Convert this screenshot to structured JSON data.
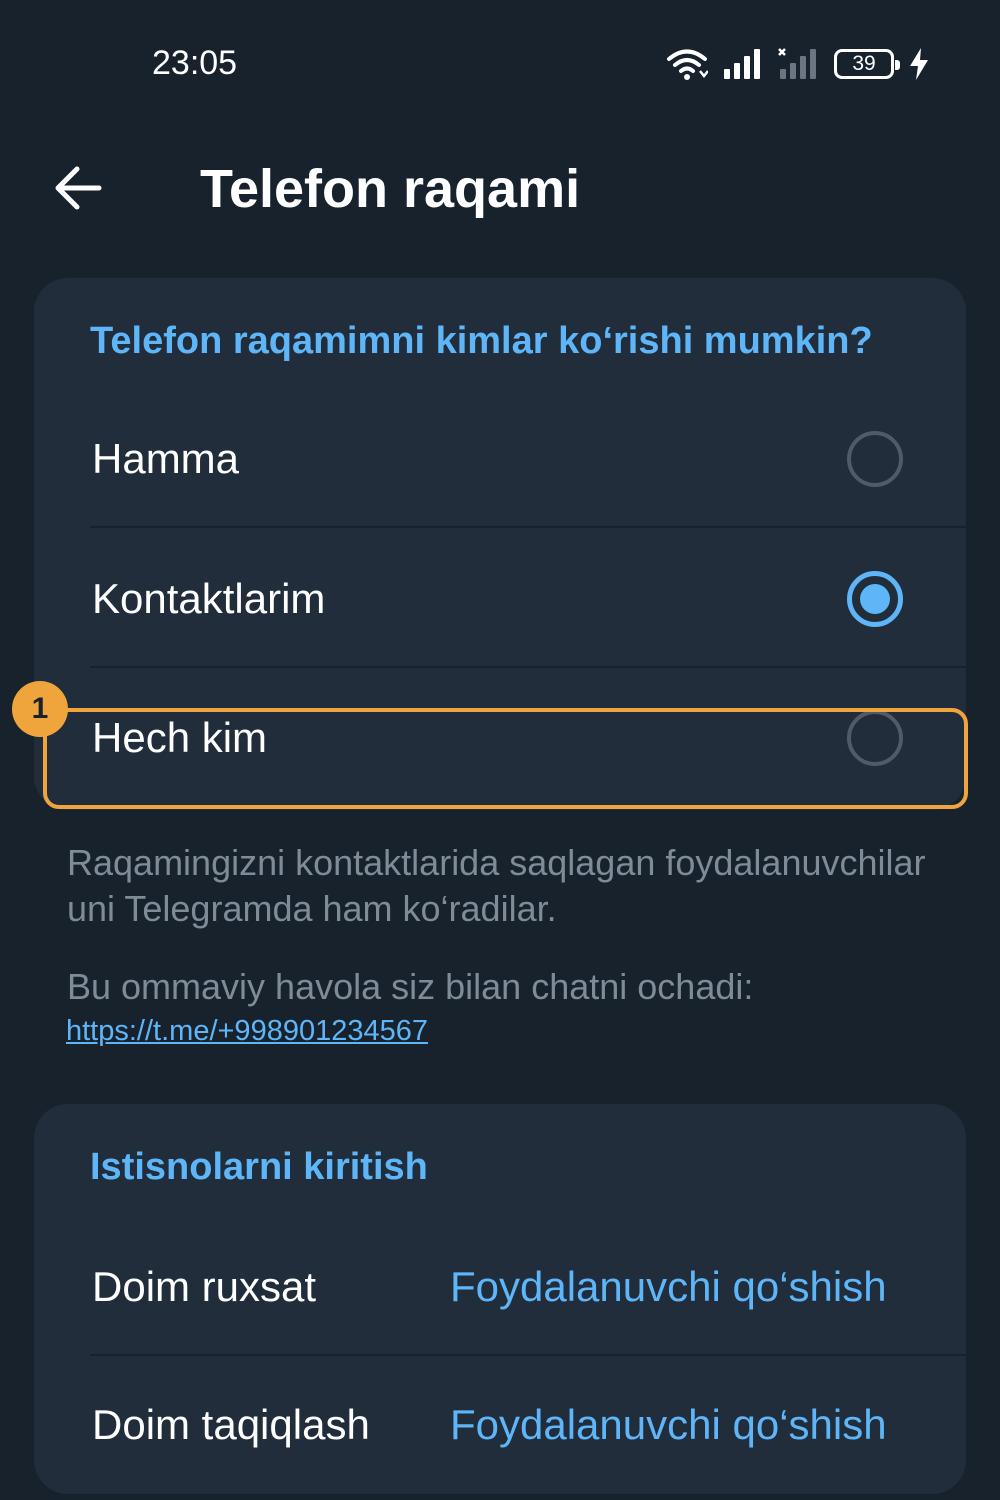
{
  "status_bar": {
    "time": "23:05",
    "battery_level": "39",
    "icons": [
      "wifi-icon",
      "signal-icon",
      "no-signal-icon",
      "battery-icon",
      "charging-icon"
    ]
  },
  "header": {
    "title": "Telefon raqami",
    "back_icon": "arrow-left-icon"
  },
  "privacy": {
    "section_title": "Telefon raqamimni kimlar ko‘rishi mumkin?",
    "options": [
      {
        "label": "Hamma",
        "selected": false
      },
      {
        "label": "Kontaktlarim",
        "selected": true
      },
      {
        "label": "Hech kim",
        "selected": false
      }
    ],
    "highlight_badge": "1"
  },
  "info": {
    "description": "Raqamingizni kontaktlarida saqlagan foydalanuvchilar uni Telegramda ham ko‘radilar.",
    "link_intro": "Bu ommaviy havola siz bilan chatni ochadi:",
    "link": "https://t.me/+998901234567"
  },
  "exceptions": {
    "section_title": "Istisnolarni kiritish",
    "rows": [
      {
        "label": "Doim ruxsat",
        "action": "Foydalanuvchi qo‘shish"
      },
      {
        "label": "Doim taqiqlash",
        "action": "Foydalanuvchi qo‘shish"
      }
    ]
  },
  "colors": {
    "background": "#18222d",
    "card": "#212d3b",
    "accent": "#5eb5f7",
    "highlight": "#f0a53c",
    "muted_text": "#7f8b97"
  }
}
